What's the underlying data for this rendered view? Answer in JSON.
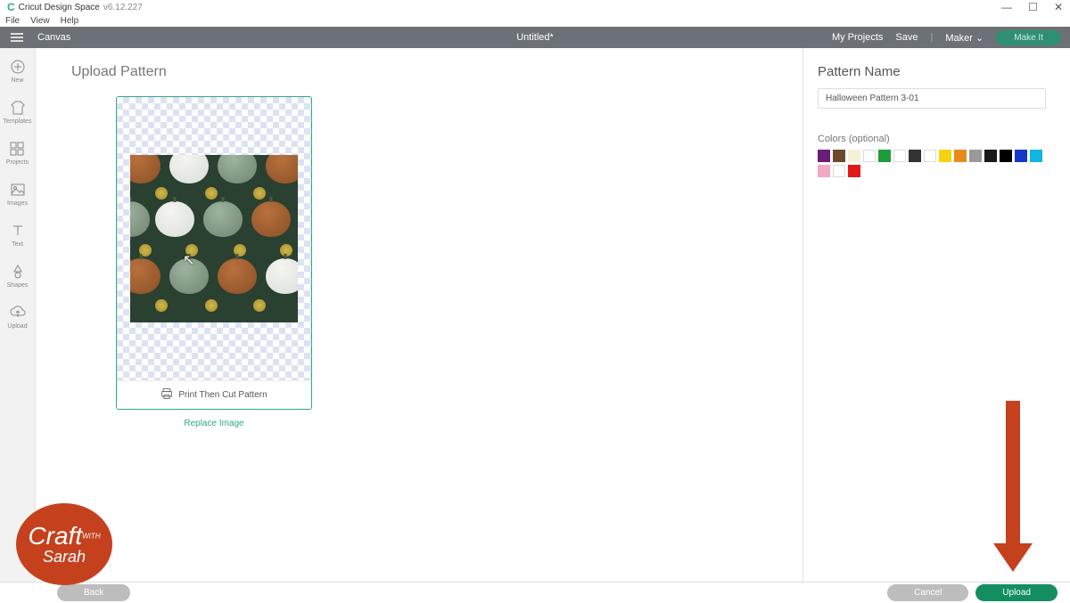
{
  "titlebar": {
    "app_name": "Cricut Design Space",
    "version": "v6.12.227"
  },
  "menubar": [
    "File",
    "View",
    "Help"
  ],
  "header": {
    "canvas_label": "Canvas",
    "document_title": "Untitled*",
    "my_projects": "My Projects",
    "save": "Save",
    "machine": "Maker",
    "make_it": "Make It"
  },
  "sidebar": [
    {
      "label": "New"
    },
    {
      "label": "Templates"
    },
    {
      "label": "Projects"
    },
    {
      "label": "Images"
    },
    {
      "label": "Text"
    },
    {
      "label": "Shapes"
    },
    {
      "label": "Upload"
    }
  ],
  "page": {
    "title": "Upload Pattern",
    "preview_caption": "Print Then Cut Pattern",
    "replace_link": "Replace Image"
  },
  "right_panel": {
    "title": "Pattern Name",
    "name_value": "Halloween Pattern 3-01",
    "colors_label": "Colors (optional)",
    "colors": [
      "#6b1b7a",
      "#6e4a2a",
      "#f5f0d8",
      "#ffffff",
      "#1e9e3a",
      "#ffffff",
      "#333333",
      "#ffffff",
      "#f5d311",
      "#e88b1a",
      "#9a9a9a",
      "#1b1b1b",
      "#000000",
      "#1538c9",
      "#11b5e0",
      "#f2a9c4",
      "#ffffff",
      "#e21919"
    ]
  },
  "footer": {
    "back": "Back",
    "cancel": "Cancel",
    "upload": "Upload"
  },
  "watermark": {
    "line1": "Craft",
    "with": "WITH",
    "line2": "Sarah"
  }
}
